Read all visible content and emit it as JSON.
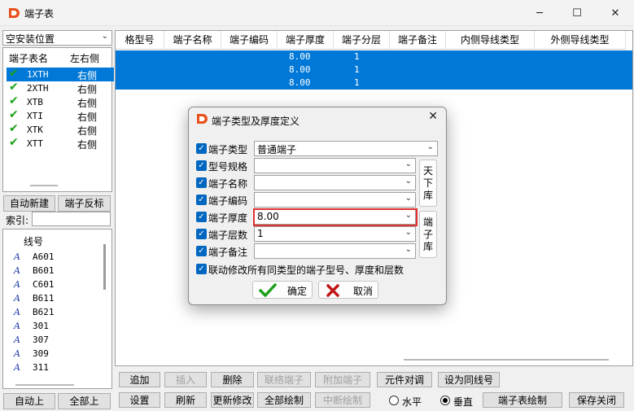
{
  "window": {
    "title": "端子表"
  },
  "location_combo": {
    "value": "空安装位置"
  },
  "terminal_list": {
    "headers": [
      "端子表名",
      "左右侧"
    ],
    "items": [
      {
        "name": "1XTH",
        "side": "右侧"
      },
      {
        "name": "2XTH",
        "side": "右侧"
      },
      {
        "name": "XTB",
        "side": "右侧"
      },
      {
        "name": "XTI",
        "side": "右侧"
      },
      {
        "name": "XTK",
        "side": "右侧"
      },
      {
        "name": "XTT",
        "side": "右侧"
      }
    ]
  },
  "left_buttons": {
    "auto_new": "自动新建",
    "reverse": "端子反标"
  },
  "index": {
    "label": "索引:",
    "value": ""
  },
  "line_list": {
    "header": "线号",
    "items": [
      "A601",
      "B601",
      "C601",
      "B611",
      "B621",
      "301",
      "307",
      "309",
      "311"
    ]
  },
  "left_bottom": {
    "auto_up": "自动上",
    "all_up": "全部上"
  },
  "grid": {
    "headers": [
      "格型号",
      "端子名称",
      "端子编码",
      "端子厚度",
      "端子分层",
      "端子备注",
      "内侧导线类型",
      "外侧导线类型"
    ],
    "rows": [
      {
        "thickness": "8.00",
        "layer": "1"
      },
      {
        "thickness": "8.00",
        "layer": "1"
      },
      {
        "thickness": "8.00",
        "layer": "1"
      }
    ]
  },
  "toolbar": {
    "row1": [
      "追加",
      "插入",
      "删除",
      "联络端子",
      "附加端子",
      "元件对调",
      "设为同线号"
    ],
    "row2": [
      "设置",
      "刷新",
      "更新修改",
      "全部绘制",
      "中断绘制"
    ],
    "radio_horizontal": "水平",
    "radio_vertical": "垂直",
    "draw": "端子表绘制",
    "save_close": "保存关闭"
  },
  "dialog": {
    "title": "端子类型及厚度定义",
    "fields": [
      {
        "label": "端子类型",
        "value": "普通端子"
      },
      {
        "label": "型号规格",
        "value": ""
      },
      {
        "label": "端子名称",
        "value": ""
      },
      {
        "label": "端子编码",
        "value": ""
      },
      {
        "label": "端子厚度",
        "value": "8.00"
      },
      {
        "label": "端子层数",
        "value": "1"
      },
      {
        "label": "端子备注",
        "value": ""
      }
    ],
    "library_top": [
      "天",
      "下",
      "库"
    ],
    "library_bottom": [
      "端",
      "子",
      "库"
    ],
    "link_checkbox": "联动修改所有同类型的端子型号、厚度和层数",
    "ok": "确定",
    "cancel": "取消"
  },
  "colors": {
    "selection": "#0078d7",
    "check": "#1aa01a",
    "highlight": "#e03030",
    "logo": "#e8501a"
  }
}
